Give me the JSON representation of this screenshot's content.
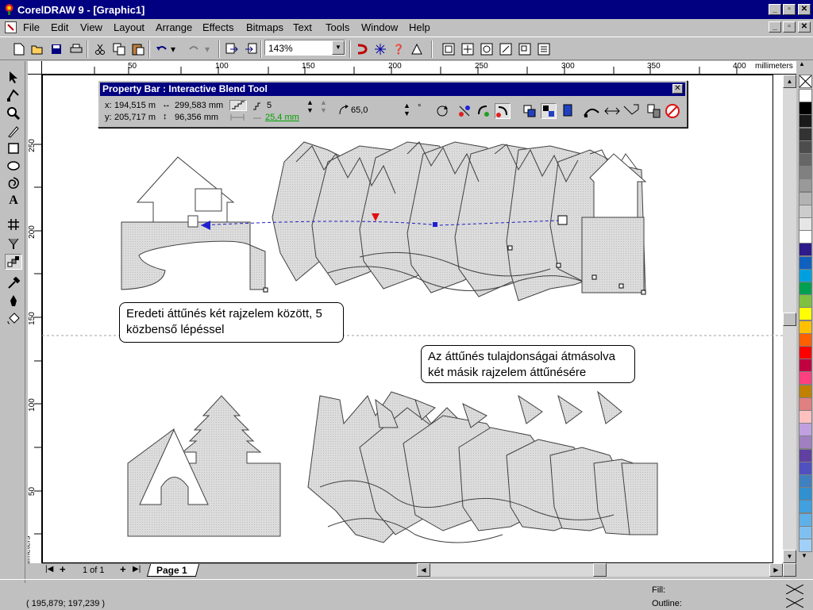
{
  "window": {
    "title": "CorelDRAW 9 - [Graphic1]",
    "caption_min": "_",
    "caption_max": "▫",
    "caption_close": "✕"
  },
  "menu": {
    "items": [
      "File",
      "Edit",
      "View",
      "Layout",
      "Arrange",
      "Effects",
      "Bitmaps",
      "Text",
      "Tools",
      "Window",
      "Help"
    ]
  },
  "toolbar": {
    "zoom_value": "143%"
  },
  "rulers": {
    "h_labels": [
      "50",
      "100",
      "150",
      "200",
      "250",
      "300",
      "350",
      "400"
    ],
    "h_unit": "millimeters",
    "v_labels": [
      "250",
      "200",
      "150",
      "100",
      "50"
    ],
    "v_unit": "millimeters"
  },
  "property_bar": {
    "title": "Property Bar : Interactive Blend Tool",
    "x_label": "x:",
    "x_value": "194,515 m",
    "y_label": "y:",
    "y_value": "205,717 m",
    "width_value": "299,583 mm",
    "height_value": "96,356 mm",
    "steps_value": "5",
    "spacing_value": "25,4 mm",
    "angle_value": "65,0",
    "angle_unit": "°"
  },
  "callouts": {
    "first": "Eredeti áttűnés két rajzelem között, 5 közbenső lépéssel",
    "second": "Az áttűnés tulajdonságai átmásolva két másik rajzelem áttűnésére"
  },
  "page_tabs": {
    "counter": "1 of 1",
    "page_label": "Page 1"
  },
  "status": {
    "coordinates": "( 195,879; 197,239 )",
    "fill_label": "Fill:",
    "outline_label": "Outline:"
  },
  "palette": {
    "colors": [
      "#ffffff",
      "#000000",
      "#1a1a1a",
      "#333333",
      "#4d4d4d",
      "#666666",
      "#808080",
      "#999999",
      "#b3b3b3",
      "#cccccc",
      "#e6e6e6",
      "#ffffff",
      "#2e1a8a",
      "#1060c0",
      "#00a0e0",
      "#00a050",
      "#80c040",
      "#ffff00",
      "#ffc000",
      "#ff6000",
      "#ff0000",
      "#c00040",
      "#ff4080",
      "#c08000",
      "#e08080",
      "#ffc0c0",
      "#c0a0e0",
      "#a080c0",
      "#6040a0",
      "#5050c0",
      "#4080c0",
      "#3090d0",
      "#40a0e0",
      "#60b0e8",
      "#80c0f0",
      "#a0d0f8"
    ]
  }
}
